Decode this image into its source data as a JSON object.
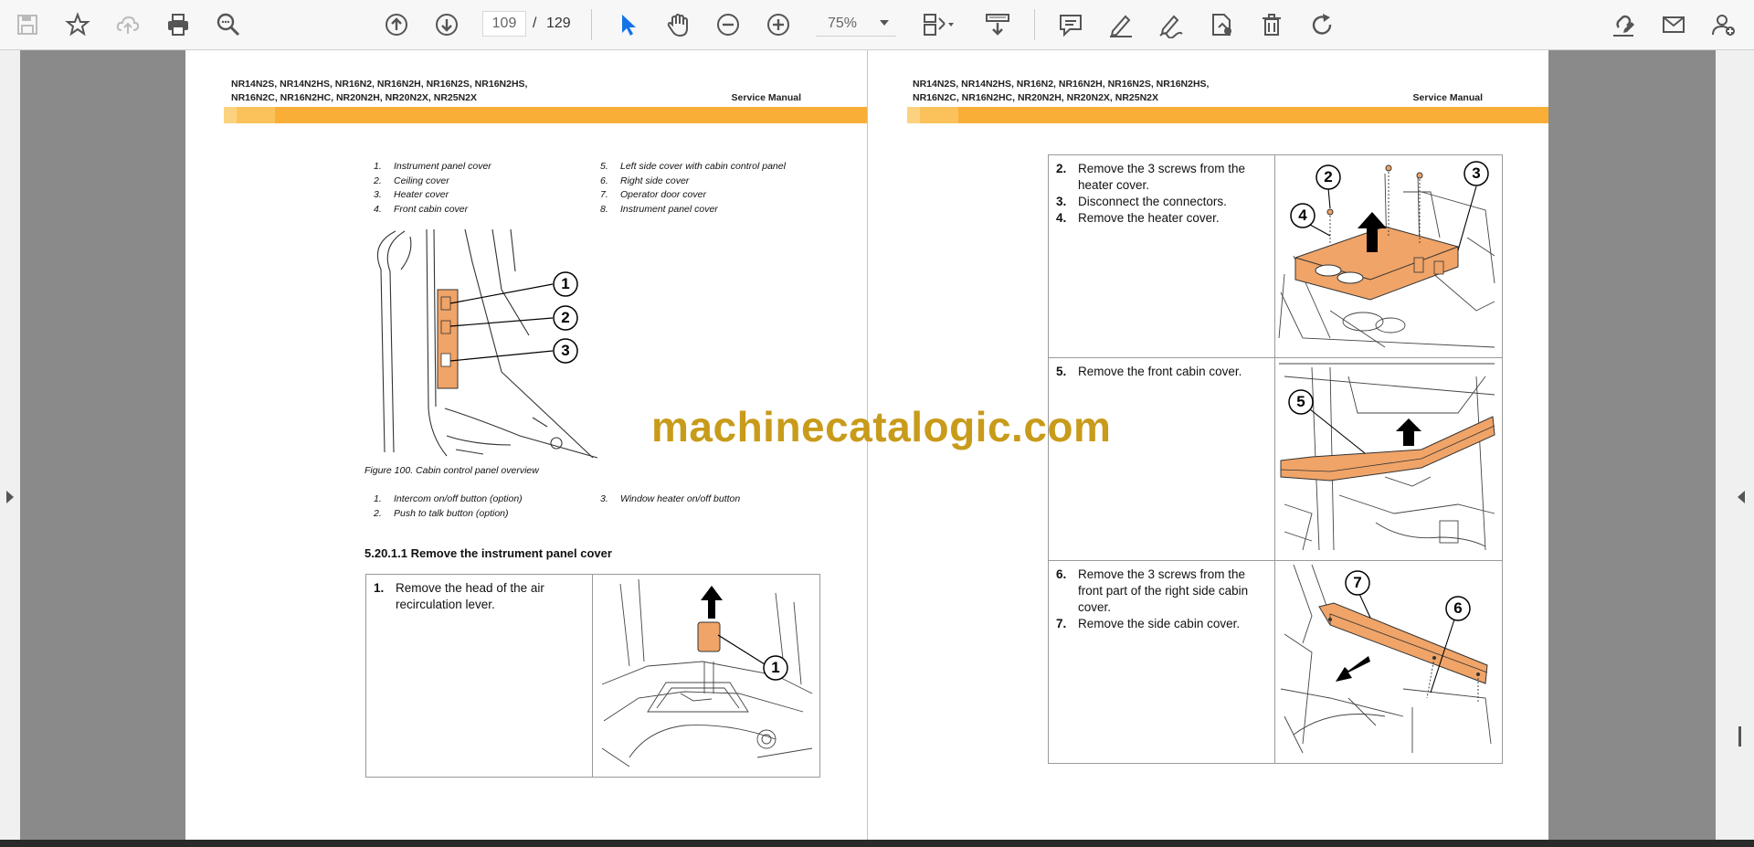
{
  "toolbar": {
    "icons": [
      "save-icon",
      "star-icon",
      "cloud-upload-icon",
      "print-icon",
      "zoom-search-icon",
      "page-up-icon",
      "page-down-icon",
      "select-cursor-icon",
      "hand-pan-icon",
      "zoom-out-icon",
      "zoom-in-icon",
      "page-layout-icon",
      "scroll-mode-icon",
      "comment-icon",
      "pen-icon",
      "sign-icon",
      "attach-icon",
      "delete-icon",
      "rotate-icon",
      "edit-pdf-icon",
      "email-icon",
      "add-user-icon"
    ],
    "current_page": "109",
    "page_separator": "/",
    "total_pages": "129",
    "zoom": "75%"
  },
  "colors": {
    "accent_blue": "#1473e6",
    "band_light": "#fcd281",
    "band_dark": "#f9ae38",
    "part_orange": "#f0a468",
    "watermark": "#c89b1a"
  },
  "left_page": {
    "header_models_line1": "NR14N2S, NR14N2HS, NR16N2, NR16N2H, NR16N2S, NR16N2HS,",
    "header_models_line2": "NR16N2C, NR16N2HC, NR20N2H, NR20N2X, NR25N2X",
    "header_manual": "Service Manual",
    "parts_legend_left": [
      {
        "num": "1.",
        "text": "Instrument panel cover"
      },
      {
        "num": "2.",
        "text": "Ceiling cover"
      },
      {
        "num": "3.",
        "text": "Heater cover"
      },
      {
        "num": "4.",
        "text": "Front cabin cover"
      }
    ],
    "parts_legend_right": [
      {
        "num": "5.",
        "text": "Left side cover with cabin control panel"
      },
      {
        "num": "6.",
        "text": "Right side cover"
      },
      {
        "num": "7.",
        "text": "Operator door cover"
      },
      {
        "num": "8.",
        "text": "Instrument panel cover"
      }
    ],
    "figure_callouts": [
      "1",
      "2",
      "3"
    ],
    "figure_caption": "Figure 100. Cabin control panel overview",
    "buttons_legend_left": [
      {
        "num": "1.",
        "text": "Intercom on/off button (option)"
      },
      {
        "num": "2.",
        "text": "Push to talk button (option)"
      }
    ],
    "buttons_legend_right": [
      {
        "num": "3.",
        "text": "Window heater on/off button"
      }
    ],
    "section_title": "5.20.1.1 Remove the instrument panel cover",
    "step1": {
      "num": "1.",
      "text": "Remove the head of the air recirculation lever.",
      "callout": "1"
    }
  },
  "right_page": {
    "header_models_line1": "NR14N2S, NR14N2HS, NR16N2, NR16N2H, NR16N2S, NR16N2HS,",
    "header_models_line2": "NR16N2C, NR16N2HC, NR20N2H, NR20N2X, NR25N2X",
    "header_manual": "Service Manual",
    "row1": {
      "steps": [
        {
          "num": "2.",
          "text": "Remove the 3 screws from the heater cover."
        },
        {
          "num": "3.",
          "text": "Disconnect the connectors."
        },
        {
          "num": "4.",
          "text": "Remove the heater cover."
        }
      ],
      "callouts": [
        "2",
        "3",
        "4"
      ]
    },
    "row2": {
      "steps": [
        {
          "num": "5.",
          "text": "Remove the front cabin cover."
        }
      ],
      "callouts": [
        "5"
      ]
    },
    "row3": {
      "steps": [
        {
          "num": "6.",
          "text": "Remove the 3 screws from the front part of the right side cabin cover."
        },
        {
          "num": "7.",
          "text": "Remove the side cabin cover."
        }
      ],
      "callouts": [
        "7",
        "6"
      ]
    }
  },
  "watermark": "machinecatalogic.com"
}
